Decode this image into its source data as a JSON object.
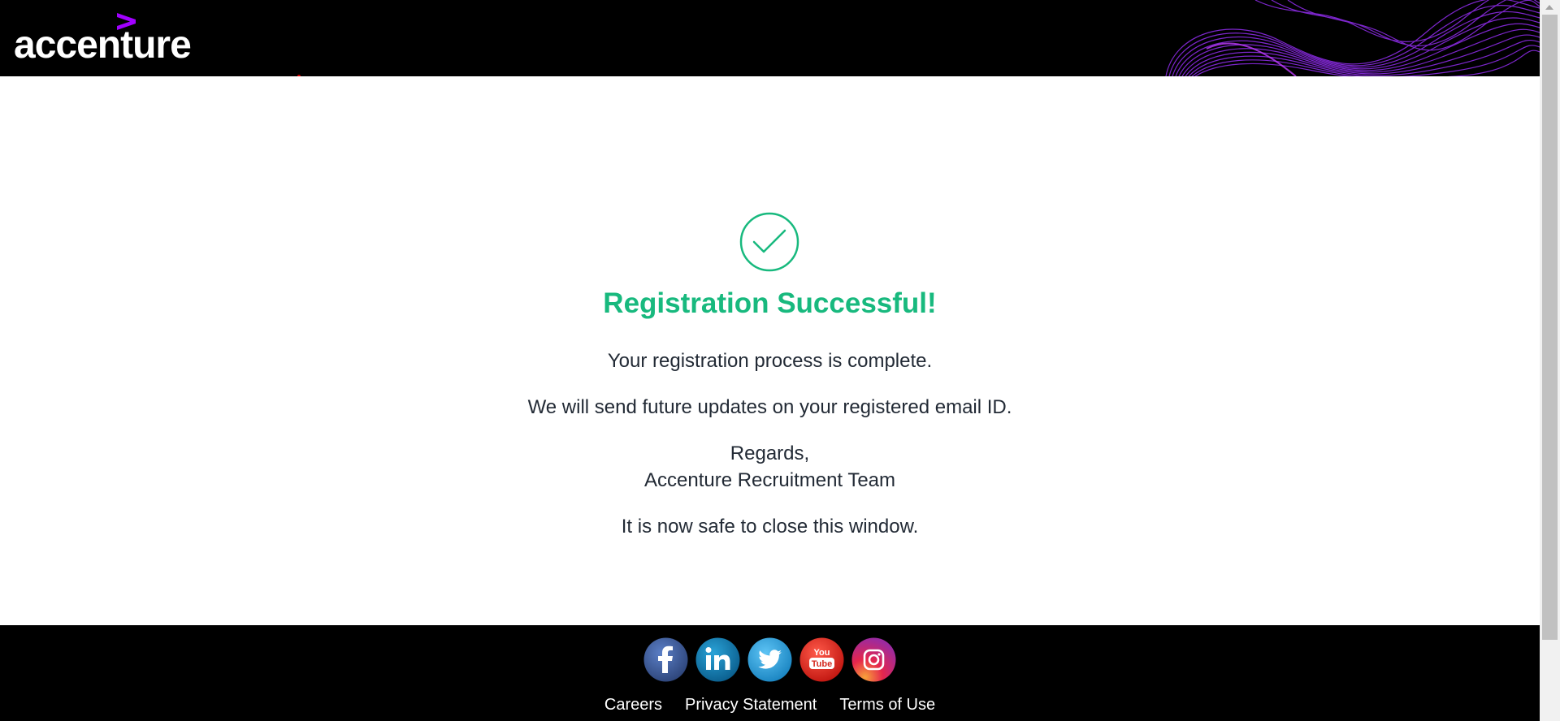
{
  "header": {
    "logo_text": "accenture",
    "brand_accent": "#a100ff"
  },
  "main": {
    "success_icon": "check-circle-icon",
    "success_color": "#18b97e",
    "title": "Registration Successful!",
    "line1": "Your registration process is complete.",
    "line2": "We will send future updates on your registered email ID.",
    "regards": "Regards,",
    "team": "Accenture Recruitment Team",
    "close_note": "It is now safe to close this window."
  },
  "footer": {
    "social": [
      {
        "name": "facebook-icon",
        "color": "#3b5998"
      },
      {
        "name": "linkedin-icon",
        "color": "#0e76a8"
      },
      {
        "name": "twitter-icon",
        "color": "#1da1f2"
      },
      {
        "name": "youtube-icon",
        "color": "#e52d27"
      },
      {
        "name": "instagram-icon",
        "color": "#e1306c"
      }
    ],
    "links": [
      "Careers",
      "Privacy Statement",
      "Terms of Use"
    ]
  }
}
